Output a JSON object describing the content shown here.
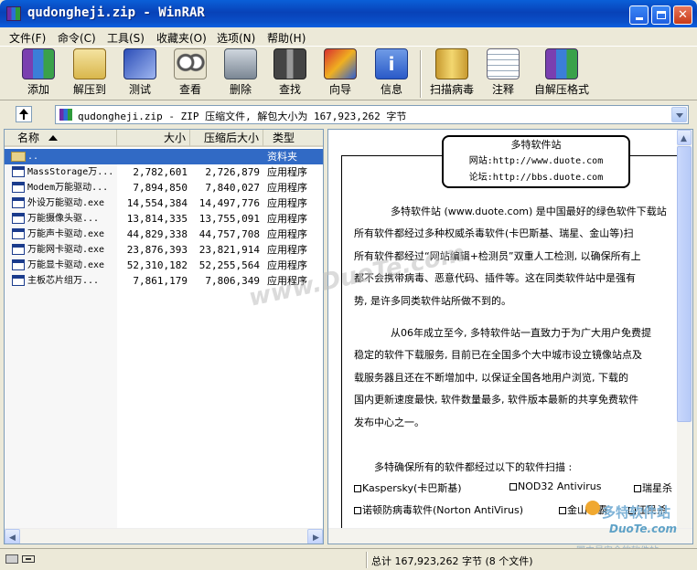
{
  "window": {
    "title": "qudongheji.zip - WinRAR"
  },
  "menu": [
    "文件(F)",
    "命令(C)",
    "工具(S)",
    "收藏夹(O)",
    "选项(N)",
    "帮助(H)"
  ],
  "toolbar": [
    {
      "label": "添加",
      "icon": "add-archive-icon"
    },
    {
      "label": "解压到",
      "icon": "extract-to-icon"
    },
    {
      "label": "测试",
      "icon": "test-icon"
    },
    {
      "label": "查看",
      "icon": "view-icon"
    },
    {
      "label": "删除",
      "icon": "delete-icon"
    },
    {
      "label": "查找",
      "icon": "find-icon"
    },
    {
      "label": "向导",
      "icon": "wizard-icon"
    },
    {
      "label": "信息",
      "icon": "info-icon"
    },
    {
      "label": "扫描病毒",
      "icon": "virus-scan-icon"
    },
    {
      "label": "注释",
      "icon": "comment-icon"
    },
    {
      "label": "自解压格式",
      "icon": "sfx-icon"
    }
  ],
  "address": {
    "text": "qudongheji.zip - ZIP 压缩文件, 解包大小为 167,923,262 字节"
  },
  "columns": {
    "name": "名称",
    "size": "大小",
    "packed": "压缩后大小",
    "type": "类型"
  },
  "files": [
    {
      "name": "..",
      "size": "",
      "packed": "",
      "type": "资料夹"
    },
    {
      "name": "MassStorage万...",
      "size": "2,782,601",
      "packed": "2,726,879",
      "type": "应用程序"
    },
    {
      "name": "Modem万能驱动...",
      "size": "7,894,850",
      "packed": "7,840,027",
      "type": "应用程序"
    },
    {
      "name": "外设万能驱动.exe",
      "size": "14,554,384",
      "packed": "14,497,776",
      "type": "应用程序"
    },
    {
      "name": "万能摄像头驱...",
      "size": "13,814,335",
      "packed": "13,755,091",
      "type": "应用程序"
    },
    {
      "name": "万能声卡驱动.exe",
      "size": "44,829,338",
      "packed": "44,757,708",
      "type": "应用程序"
    },
    {
      "name": "万能网卡驱动.exe",
      "size": "23,876,393",
      "packed": "23,821,914",
      "type": "应用程序"
    },
    {
      "name": "万能显卡驱动.exe",
      "size": "52,310,182",
      "packed": "52,255,564",
      "type": "应用程序"
    },
    {
      "name": "主板芯片组万...",
      "size": "7,861,179",
      "packed": "7,806,349",
      "type": "应用程序"
    }
  ],
  "comment": {
    "header_title": "多特软件站",
    "header_site": "网站:http://www.duote.com",
    "header_forum": "论坛:http://bbs.duote.com",
    "paragraphs": [
      "多特软件站 (www.duote.com) 是中国最好的绿色软件下载站",
      "所有软件都经过多种权威杀毒软件(卡巴斯基、瑞星、金山等)扫",
      "所有软件都经过“网站编辑+检测员”双重人工检测, 以确保所有上",
      "都不会携带病毒、恶意代码、插件等。这在同类软件站中是强有",
      "势, 是许多同类软件站所做不到的。",
      "从06年成立至今, 多特软件站一直致力于为广大用户免费提",
      "稳定的软件下载服务, 目前已在全国多个大中城市设立镜像站点及",
      "载服务器且还在不断增加中, 以保证全国各地用户浏览, 下载的",
      "国内更新速度最快, 软件数量最多, 软件版本最新的共享免费软件",
      "发布中心之一。"
    ],
    "scan_intro": "多特确保所有的软件都经过以下的软件扫描 :",
    "scanners_row1": [
      "Kaspersky(卡巴斯基)",
      "NOD32 Antivirus",
      "瑞星杀"
    ],
    "scanners_row2": [
      "诺顿防病毒软件(Norton AntiVirus)",
      "金山毒霸",
      "江民杀"
    ]
  },
  "watermark": "www.DuoTe.com",
  "logo_watermark": {
    "line1": "多特软件站",
    "line2": "DuoTe.com",
    "line3": "国内最安全的软件站"
  },
  "status": {
    "text": "总计 167,923,262 字节 (8 个文件)"
  }
}
